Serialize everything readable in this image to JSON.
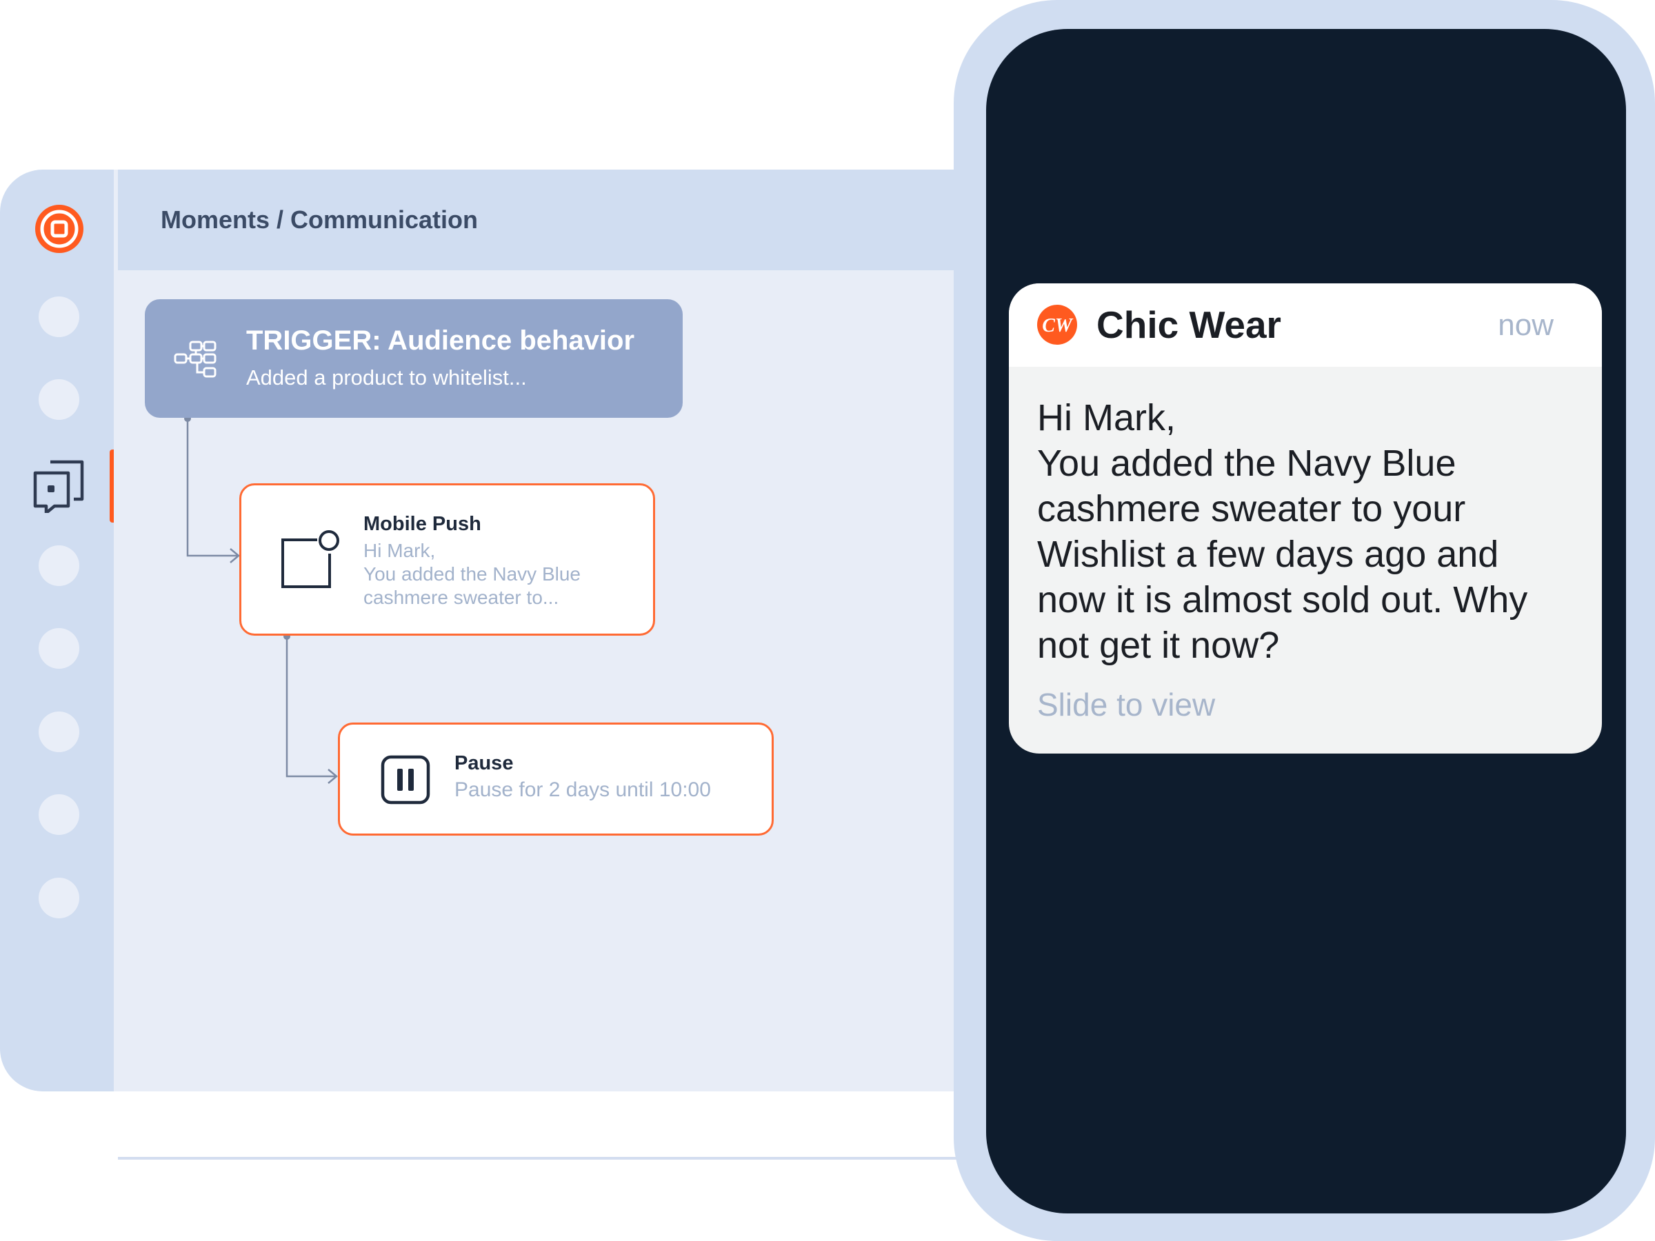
{
  "app": {
    "breadcrumb": "Moments / Communication",
    "brand_color": "#ff5a1f",
    "sidebar": {
      "items": [
        {
          "icon": "placeholder-dot"
        },
        {
          "icon": "placeholder-dot"
        },
        {
          "icon": "communication-icon",
          "active": true
        },
        {
          "icon": "placeholder-dot"
        },
        {
          "icon": "placeholder-dot"
        },
        {
          "icon": "placeholder-dot"
        },
        {
          "icon": "placeholder-dot"
        },
        {
          "icon": "placeholder-dot"
        }
      ]
    },
    "flow": {
      "trigger": {
        "title": "TRIGGER: Audience behavior",
        "subtitle": "Added a product to whitelist..."
      },
      "mobile_push": {
        "title": "Mobile Push",
        "lines": [
          "Hi Mark,",
          "You added the Navy Blue",
          "cashmere sweater to..."
        ]
      },
      "pause": {
        "title": "Pause",
        "subtitle": "Pause for 2 days until 10:00"
      }
    }
  },
  "phone": {
    "notification": {
      "app_logo_text": "CW",
      "app_name": "Chic Wear",
      "time": "now",
      "body_lines": [
        "Hi Mark,",
        "You added the Navy Blue",
        "cashmere sweater to your",
        "Wishlist a few days ago and",
        "now it is almost sold out. Why",
        "not get it now?"
      ],
      "cta": "Slide to view"
    }
  }
}
